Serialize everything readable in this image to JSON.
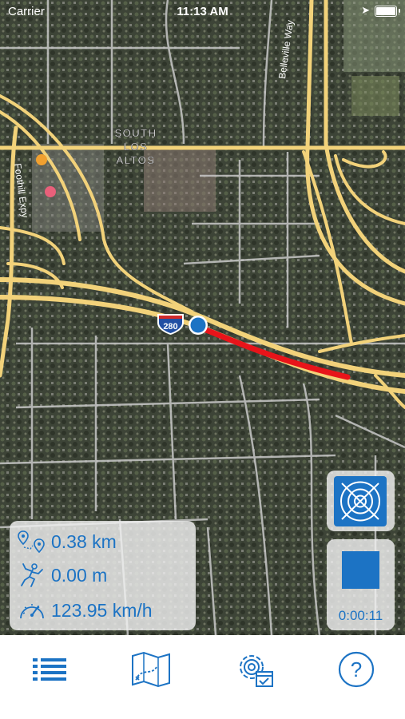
{
  "status_bar": {
    "carrier": "Carrier",
    "time": "11:13 AM"
  },
  "map": {
    "labels": {
      "area": [
        "SOUTH",
        "LOS",
        "ALTOS"
      ],
      "road_1": "Foothill Expy",
      "road_2": "Belleville Way",
      "shield": "280"
    }
  },
  "stats": {
    "distance": "0.38 km",
    "altitude": "0.00 m",
    "speed": "123.95 km/h"
  },
  "controls": {
    "timer": "0:00:11"
  },
  "tabbar": {
    "icons": [
      "list-icon",
      "map-icon",
      "settings-icon",
      "help-icon"
    ]
  },
  "colors": {
    "accent": "#1c73c4",
    "track": "#e8141a",
    "road": "#f2d27a"
  }
}
